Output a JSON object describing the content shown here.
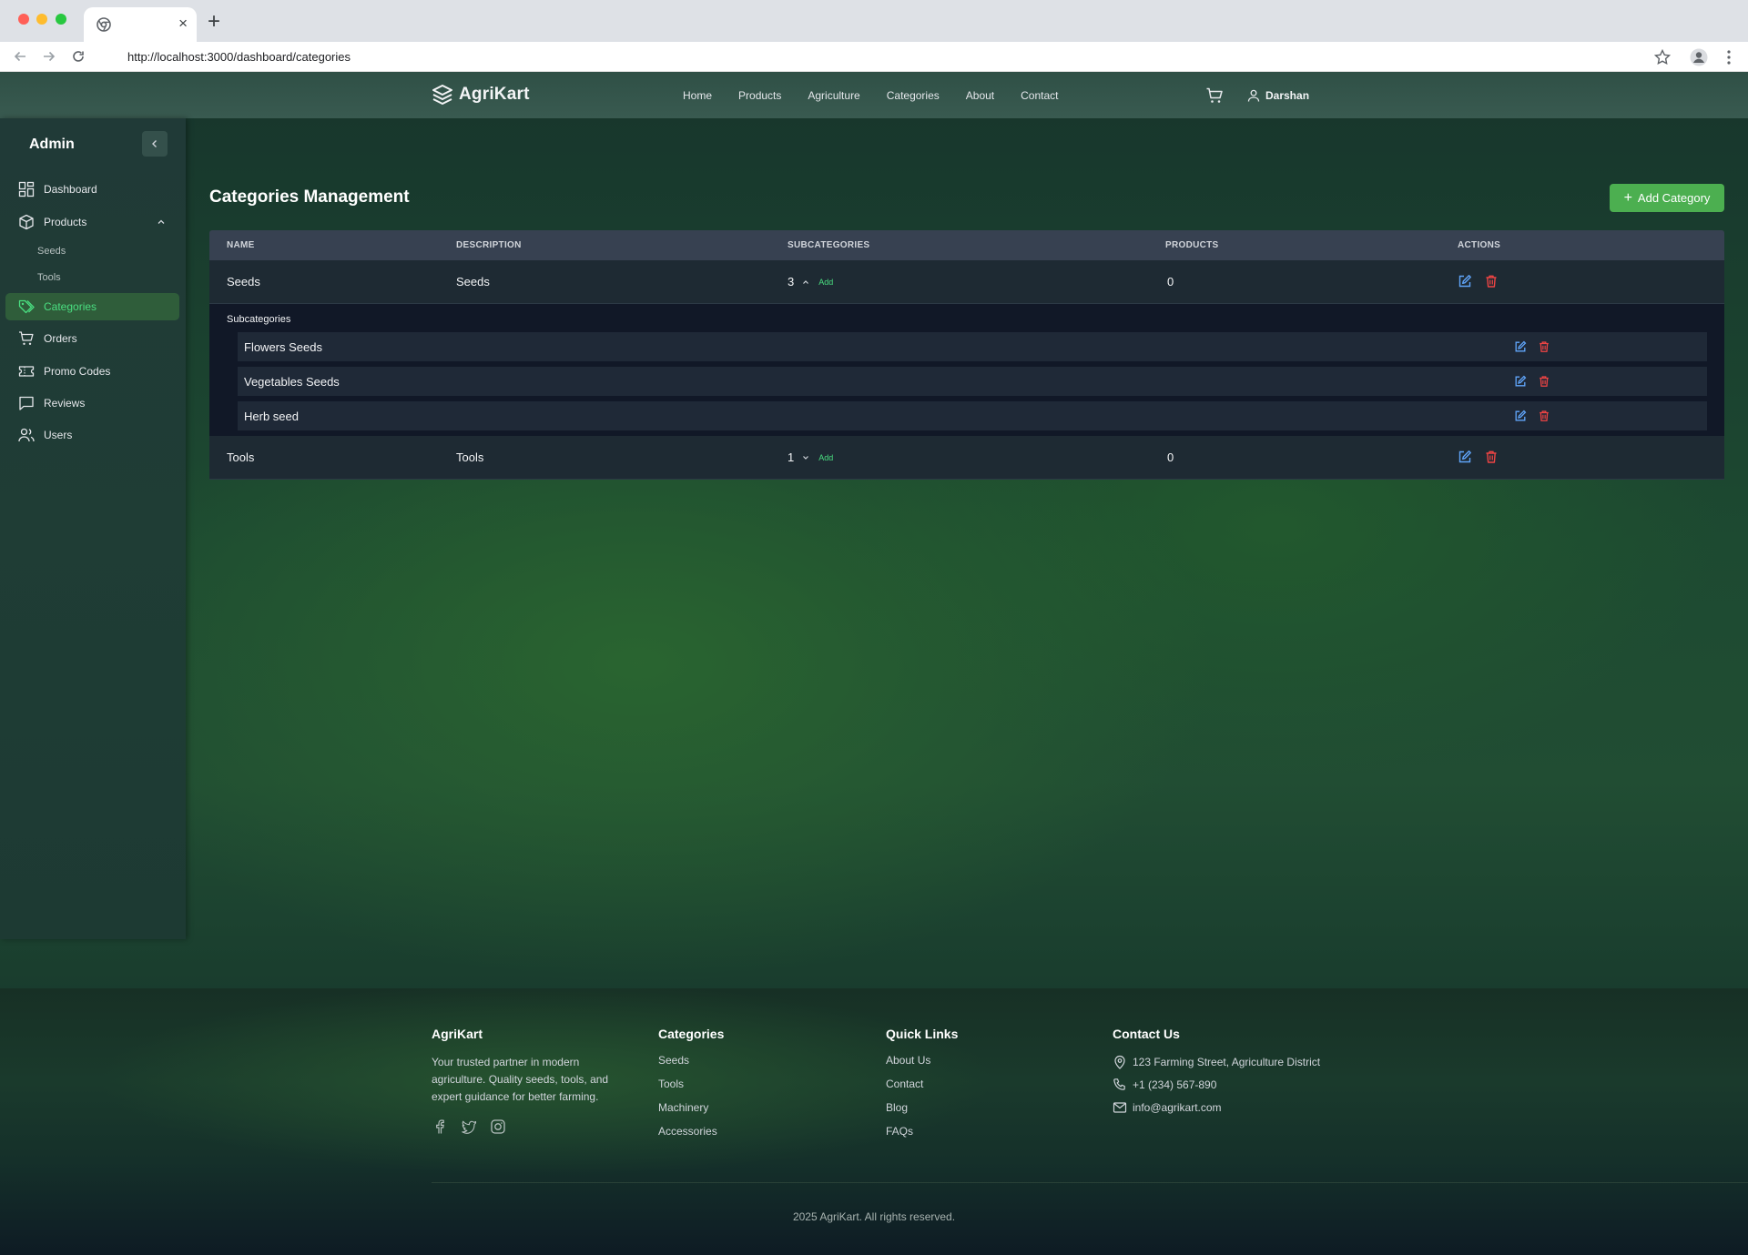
{
  "browser": {
    "url": "http://localhost:3000/dashboard/categories",
    "new_tab": "+",
    "tab_close": "×"
  },
  "header": {
    "brand": "AgriKart",
    "nav": [
      "Home",
      "Products",
      "Agriculture",
      "Categories",
      "About",
      "Contact"
    ],
    "user": "Darshan"
  },
  "sidebar": {
    "title": "Admin",
    "items": [
      {
        "label": "Dashboard",
        "icon": "dashboard-icon"
      },
      {
        "label": "Products",
        "icon": "box-icon"
      },
      {
        "label": "Categories",
        "icon": "tags-icon",
        "active": true
      },
      {
        "label": "Orders",
        "icon": "cart-icon"
      },
      {
        "label": "Promo Codes",
        "icon": "ticket-icon"
      },
      {
        "label": "Reviews",
        "icon": "message-icon"
      },
      {
        "label": "Users",
        "icon": "users-icon"
      }
    ],
    "product_sub": [
      "Seeds",
      "Tools"
    ]
  },
  "main": {
    "title": "Categories Management",
    "add_button": "Add Category",
    "columns": [
      "NAME",
      "DESCRIPTION",
      "SUBCATEGORIES",
      "PRODUCTS",
      "ACTIONS"
    ],
    "rows": [
      {
        "name": "Seeds",
        "description": "Seeds",
        "subcount": "3",
        "products": "0",
        "add": "Add",
        "expanded": true
      },
      {
        "name": "Tools",
        "description": "Tools",
        "subcount": "1",
        "products": "0",
        "add": "Add",
        "expanded": false
      }
    ],
    "subcategories_heading": "Subcategories",
    "subcategories": [
      "Flowers Seeds",
      "Vegetables Seeds",
      "Herb seed"
    ]
  },
  "footer": {
    "brand": "AgriKart",
    "tagline": "Your trusted partner in modern agriculture. Quality seeds, tools, and expert guidance for better farming.",
    "categories_heading": "Categories",
    "categories": [
      "Seeds",
      "Tools",
      "Machinery",
      "Accessories"
    ],
    "quick_heading": "Quick Links",
    "quick_links": [
      "About Us",
      "Contact",
      "Blog",
      "FAQs"
    ],
    "contact_heading": "Contact Us",
    "address": "123 Farming Street, Agriculture District",
    "phone": "+1 (234) 567-890",
    "email": "info@agrikart.com",
    "copyright": "2025 AgriKart. All rights reserved."
  },
  "colors": {
    "accent_green": "#4caf50",
    "active_text": "#4ade80",
    "edit_blue": "#60a5fa",
    "delete_red": "#f87171"
  }
}
